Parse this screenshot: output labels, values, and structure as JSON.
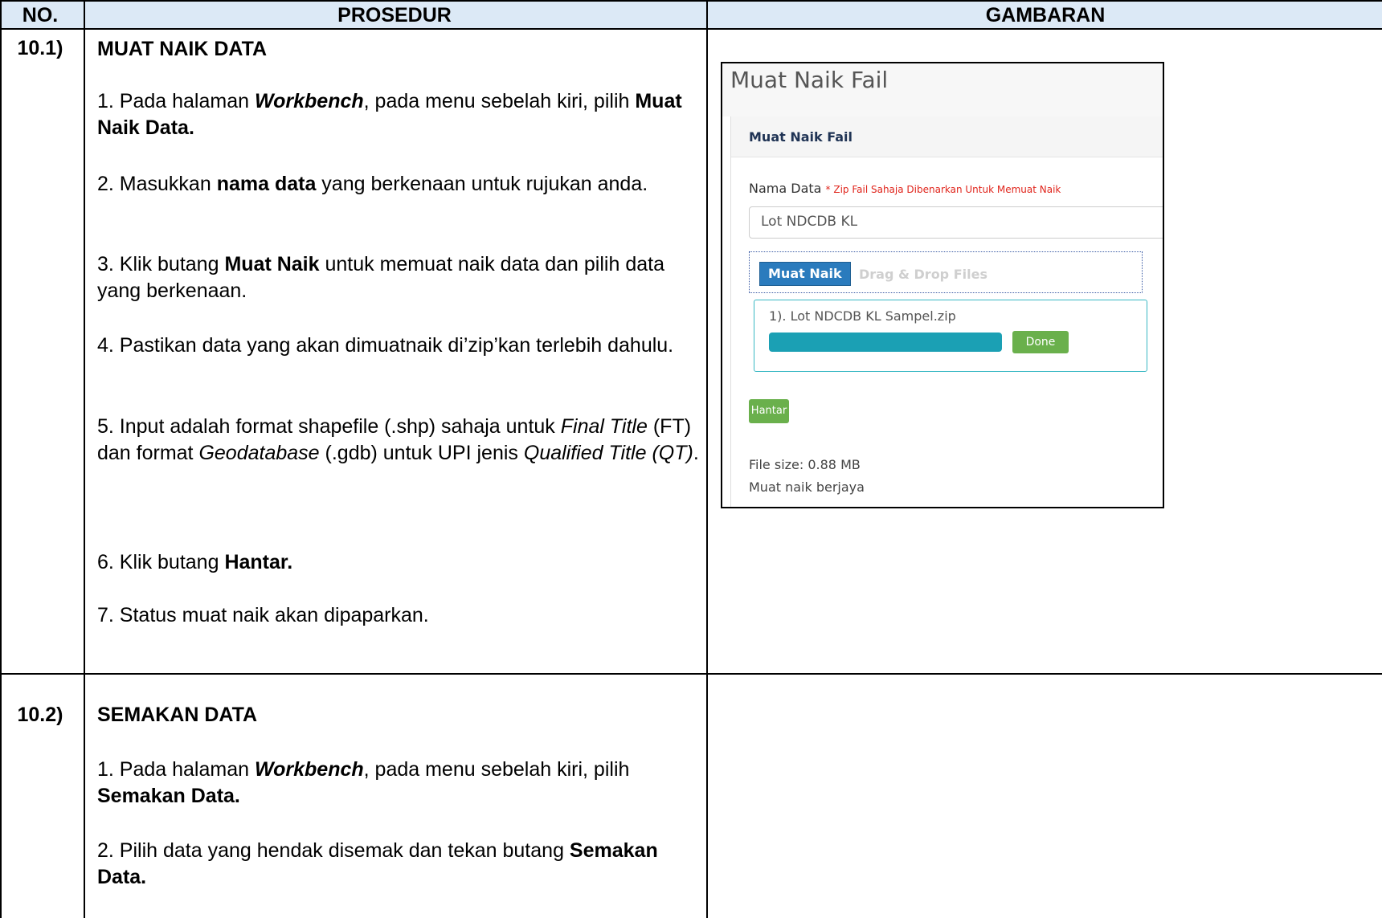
{
  "header": {
    "no": "NO.",
    "prosedur": "PROSEDUR",
    "gambaran": "GAMBARAN"
  },
  "section1": {
    "number": "10.1)",
    "title": "MUAT NAIK DATA",
    "step1": {
      "a": "1. Pada halaman ",
      "b": "Workbench",
      "c": ", pada menu sebelah kiri, pilih ",
      "d": "Muat Naik Data."
    },
    "step2": {
      "a": "2. Masukkan ",
      "b": "nama data",
      "c": " yang berkenaan untuk rujukan anda."
    },
    "step3": {
      "a": "3. Klik butang ",
      "b": "Muat Naik",
      "c": " untuk memuat naik data dan pilih data yang berkenaan."
    },
    "step4": {
      "a": "4. Pastikan data yang akan dimuatnaik di’zip’kan terlebih dahulu."
    },
    "step5": {
      "a": "5. Input adalah format shapefile (.shp) sahaja untuk ",
      "b": "Final Title",
      "c": " (FT) dan format ",
      "d": "Geodatabase",
      "e": " (.gdb) untuk UPI jenis ",
      "f": "Qualified Title (QT)",
      "g": "."
    },
    "step6": {
      "a": "6. Klik butang ",
      "b": "Hantar."
    },
    "step7": {
      "a": "7. Status muat naik akan dipaparkan."
    }
  },
  "section2": {
    "number": "10.2)",
    "title": "SEMAKAN DATA",
    "step1": {
      "a": "1. Pada halaman ",
      "b": "Workbench",
      "c": ", pada menu sebelah kiri, pilih ",
      "d": "Semakan Data."
    },
    "step2": {
      "a": "2. Pilih data yang hendak disemak dan tekan butang ",
      "b": "Semakan Data."
    }
  },
  "screenshot": {
    "page_title": "Muat Naik Fail",
    "panel_title": "Muat Naik Fail",
    "field_label": "Nama Data",
    "field_note": "* Zip Fail Sahaja Dibenarkan Untuk Memuat Naik",
    "field_value": "Lot NDCDB KL",
    "upload_button": "Muat Naik",
    "drag_text": "Drag & Drop Files",
    "file_name": "1). Lot NDCDB KL Sampel.zip",
    "progress_percent": 100,
    "done_button": "Done",
    "submit_button": "Hantar",
    "file_size": "File size: 0.88 MB",
    "status": "Muat naik berjaya",
    "colors": {
      "upload": "#2a7bbd",
      "progress": "#1ba0b4",
      "success": "#6ab04c",
      "required": "#e0241b"
    }
  }
}
